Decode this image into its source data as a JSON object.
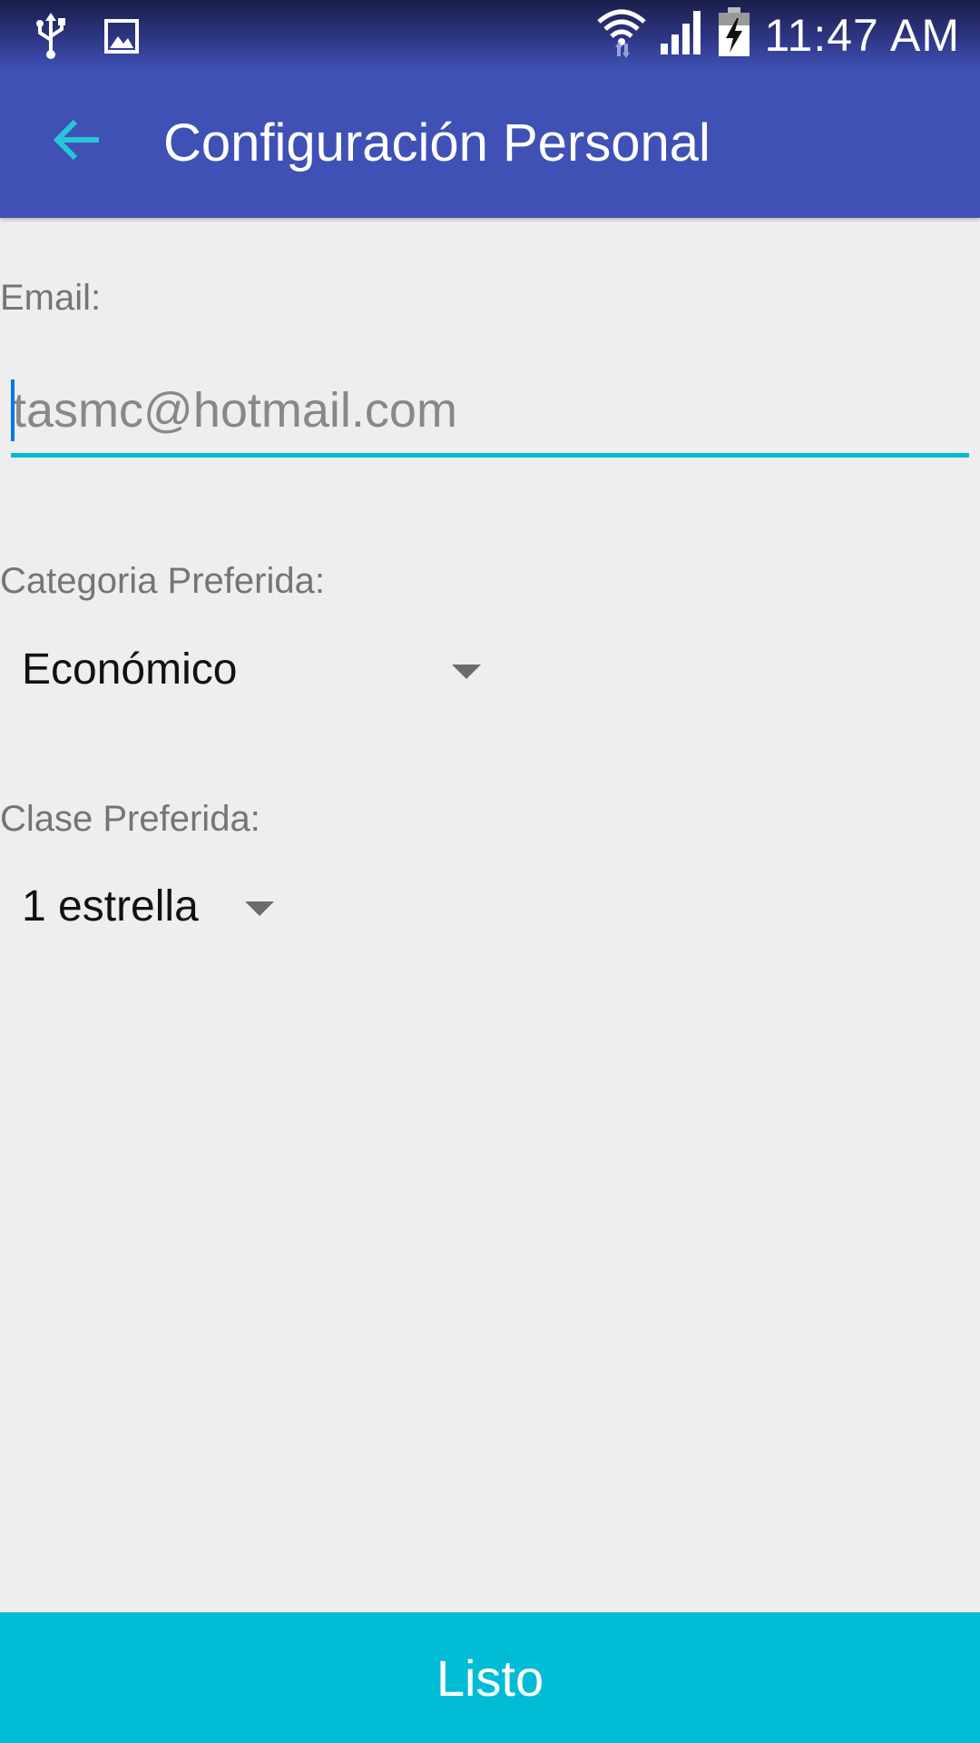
{
  "status_bar": {
    "time": "11:47 AM",
    "icons": [
      "usb-icon",
      "image-icon",
      "wifi-icon",
      "signal-icon",
      "battery-charging-icon"
    ]
  },
  "app_bar": {
    "title": "Configuración Personal",
    "back_icon": "arrow-back-icon"
  },
  "form": {
    "email_label": "Email:",
    "email_placeholder": "tasmc@hotmail.com",
    "email_value": "",
    "category_label": "Categoria Preferida:",
    "category_value": "Económico",
    "class_label": "Clase Preferida:",
    "class_value": "1 estrella"
  },
  "done_button": {
    "label": "Listo"
  },
  "colors": {
    "primary": "#3f51b5",
    "accent": "#00bcd4",
    "background": "#eeeeee"
  }
}
